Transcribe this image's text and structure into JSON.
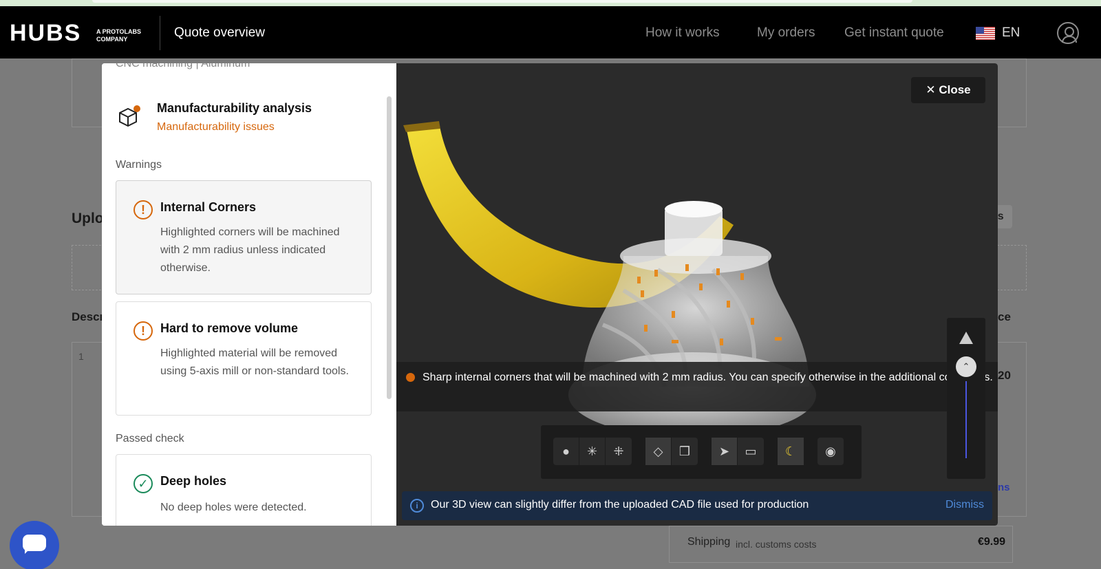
{
  "nav": {
    "logo": "HUBS",
    "logo_sub": "A PROTOLABS COMPANY",
    "title": "Quote overview",
    "links": [
      "How it works",
      "My orders",
      "Get instant quote"
    ],
    "language": "EN"
  },
  "background": {
    "upload_heading_partial": "Uplo",
    "upload_files_partial": "iles",
    "description_partial": "Descr",
    "price_partial": "ce",
    "row_number": "1",
    "price_partial_value": "20",
    "options_partial": "ns",
    "shipping_label": "Shipping",
    "shipping_note": "incl. customs costs",
    "shipping_price": "€9.99"
  },
  "modal": {
    "process_subtitle": "CNC machining  |  Aluminum",
    "analysis_title": "Manufacturability analysis",
    "analysis_status": "Manufacturability issues",
    "warnings_label": "Warnings",
    "warnings": [
      {
        "title": "Internal Corners",
        "description": "Highlighted corners will be machined with 2 mm radius unless indicated otherwise."
      },
      {
        "title": "Hard to remove volume",
        "description": "Highlighted material will be removed using 5-axis mill or non-standard tools."
      }
    ],
    "passed_label": "Passed check",
    "passed": [
      {
        "title": "Deep holes",
        "description": "No deep holes were detected."
      }
    ]
  },
  "viewer": {
    "close_label": "Close",
    "banner_text": "Sharp internal corners that will be machined with 2 mm radius. You can specify otherwise in the additional comments.",
    "info_text": "Our 3D view can slightly differ from the uploaded CAD file used for production",
    "dismiss_label": "Dismiss",
    "toolbar_icons": [
      "sphere-icon",
      "axis-icon",
      "explode-icon",
      "perspective-icon",
      "orthographic-icon",
      "navigate-icon",
      "measure-icon",
      "banana-scale-icon",
      "screenshot-icon"
    ]
  },
  "colors": {
    "accent_orange": "#d6670c",
    "ok_green": "#1a8a5a",
    "link_blue": "#4f8ad8",
    "chat_blue": "#2e54c8"
  }
}
